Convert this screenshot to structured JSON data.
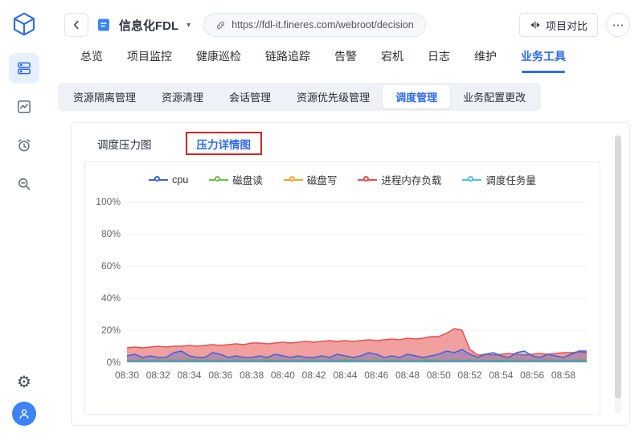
{
  "icons": {
    "more": "⋯",
    "gear": "⚙",
    "caret_down": "▾"
  },
  "header": {
    "title": "信息化FDL",
    "url": "https://fdl-it.fineres.com/webroot/decision",
    "compare_label": "项目对比"
  },
  "nav": {
    "tabs": [
      "总览",
      "项目监控",
      "健康巡检",
      "链路追踪",
      "告警",
      "宕机",
      "日志",
      "维护",
      "业务工具"
    ],
    "active": "业务工具"
  },
  "subnav": {
    "tabs": [
      "资源隔离管理",
      "资源清理",
      "会话管理",
      "资源优先级管理",
      "调度管理",
      "业务配置更改"
    ],
    "active": "调度管理"
  },
  "panel": {
    "tabs": [
      "调度压力图",
      "压力详情图"
    ],
    "active": "压力详情图"
  },
  "chart_data": {
    "type": "area",
    "title": "",
    "xlabel": "",
    "ylabel": "",
    "ylim": [
      0,
      100
    ],
    "y_ticks": [
      "0%",
      "20%",
      "40%",
      "60%",
      "80%",
      "100%"
    ],
    "x_tick_labels": [
      "08:30",
      "08:32",
      "08:34",
      "08:36",
      "08:38",
      "08:40",
      "08:42",
      "08:44",
      "08:46",
      "08:48",
      "08:50",
      "08:52",
      "08:54",
      "08:56",
      "08:58"
    ],
    "grid": true,
    "legend_position": "top",
    "series": [
      {
        "name": "cpu",
        "color": "#3D64D8",
        "values": [
          4,
          5,
          3,
          4,
          3,
          3,
          6,
          7,
          4,
          3,
          3,
          6,
          5,
          3,
          4,
          3,
          3,
          4,
          3,
          5,
          4,
          3,
          4,
          3,
          3,
          4,
          3,
          5,
          4,
          3,
          4,
          6,
          5,
          3,
          4,
          3,
          5,
          4,
          3,
          4,
          5,
          7,
          6,
          8,
          5,
          3,
          5,
          6,
          4,
          3,
          6,
          7,
          4,
          3,
          5,
          4,
          3,
          5,
          7,
          7
        ]
      },
      {
        "name": "磁盘读",
        "color": "#6FBF4D",
        "values": [
          1,
          0.8,
          1.1,
          0.9,
          1.2,
          0.8,
          1,
          0.9,
          1.1,
          1,
          1,
          0.8,
          1.1,
          0.9,
          1.2,
          0.8,
          1,
          0.9,
          1.1,
          1,
          1,
          0.8,
          1.1,
          0.9,
          1.2,
          0.8,
          1,
          0.9,
          1.1,
          1,
          1,
          0.8,
          1.1,
          0.9,
          1.2,
          0.8,
          1,
          0.9,
          1.1,
          1,
          1,
          0.8,
          1.1,
          0.9,
          1.2,
          0.8,
          1,
          0.9,
          1.1,
          1,
          1,
          0.8,
          1.1,
          0.9,
          1.2,
          0.8,
          1,
          0.9,
          1.1,
          1
        ]
      },
      {
        "name": "磁盘写",
        "color": "#F5A623",
        "values": [
          1.5,
          1.2,
          1.8,
          1.1,
          2,
          1.3,
          1.6,
          1.2,
          2.1,
          1.4,
          1.5,
          1.2,
          1.8,
          1.1,
          2,
          1.3,
          1.6,
          1.2,
          2.1,
          1.4,
          1.5,
          1.2,
          1.8,
          1.1,
          2,
          1.3,
          1.6,
          1.2,
          2.1,
          1.4,
          1.5,
          1.2,
          1.8,
          1.1,
          2,
          1.3,
          1.6,
          1.2,
          2.1,
          1.4,
          1.5,
          1.2,
          1.8,
          1.1,
          2,
          1.3,
          1.6,
          1.2,
          2.1,
          1.4,
          1.5,
          1.2,
          1.8,
          1.1,
          2,
          1.3,
          1.6,
          1.2,
          2.1,
          1.4
        ]
      },
      {
        "name": "进程内存负载",
        "color": "#E85050",
        "values": [
          9,
          9.5,
          9,
          9.5,
          10,
          9.5,
          10,
          10,
          10.5,
          10,
          10.5,
          11,
          10.5,
          11,
          11.5,
          11,
          12,
          12,
          11.5,
          12,
          12.5,
          12,
          12.5,
          13,
          12.5,
          13,
          13.5,
          13,
          13.5,
          13,
          13.5,
          14,
          13.5,
          14,
          14.5,
          14,
          15,
          14.5,
          15,
          16,
          16,
          18,
          21,
          20,
          8,
          4.5,
          5,
          4.5,
          5,
          5.5,
          5,
          4.5,
          5,
          5.5,
          5,
          5.5,
          6,
          6,
          6.5,
          6
        ]
      },
      {
        "name": "调度任务量",
        "color": "#4FC1E9",
        "values": [
          0.5,
          0.4,
          0.6,
          0.5,
          0.7,
          0.4,
          0.5,
          0.6,
          0.4,
          0.5,
          0.5,
          0.4,
          0.6,
          0.5,
          0.7,
          0.4,
          0.5,
          0.6,
          0.4,
          0.5,
          0.5,
          0.4,
          0.6,
          0.5,
          0.7,
          0.4,
          0.5,
          0.6,
          0.4,
          0.5,
          0.5,
          0.4,
          0.6,
          0.5,
          0.7,
          0.4,
          0.5,
          0.6,
          0.4,
          0.5,
          0.5,
          0.4,
          0.6,
          0.5,
          0.7,
          0.4,
          0.5,
          0.6,
          0.4,
          0.5,
          0.5,
          0.4,
          0.6,
          0.5,
          0.7,
          0.4,
          0.5,
          0.6,
          0.4,
          0.5
        ]
      }
    ]
  }
}
